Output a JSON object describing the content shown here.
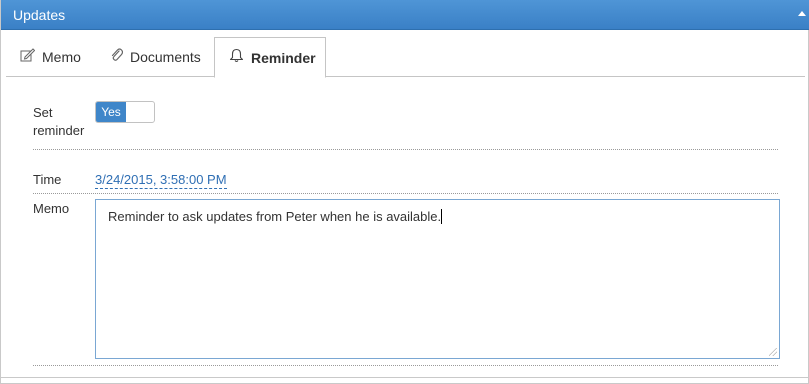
{
  "panel": {
    "title": "Updates"
  },
  "tabs": [
    {
      "label": "Memo",
      "icon": "pencil-icon"
    },
    {
      "label": "Documents",
      "icon": "paperclip-icon"
    },
    {
      "label": "Reminder",
      "icon": "bell-icon",
      "selected": true
    }
  ],
  "form": {
    "set_reminder_label_line1": "Set",
    "set_reminder_label_line2": "reminder",
    "toggle_value": "Yes",
    "time_label": "Time",
    "time_value": "3/24/2015, 3:58:00 PM",
    "memo_label": "Memo",
    "memo_text": "Reminder to ask updates from Peter when he is available."
  },
  "colors": {
    "header": "#3a80c6",
    "accent": "#3f86c9",
    "link": "#2f6fb4"
  }
}
